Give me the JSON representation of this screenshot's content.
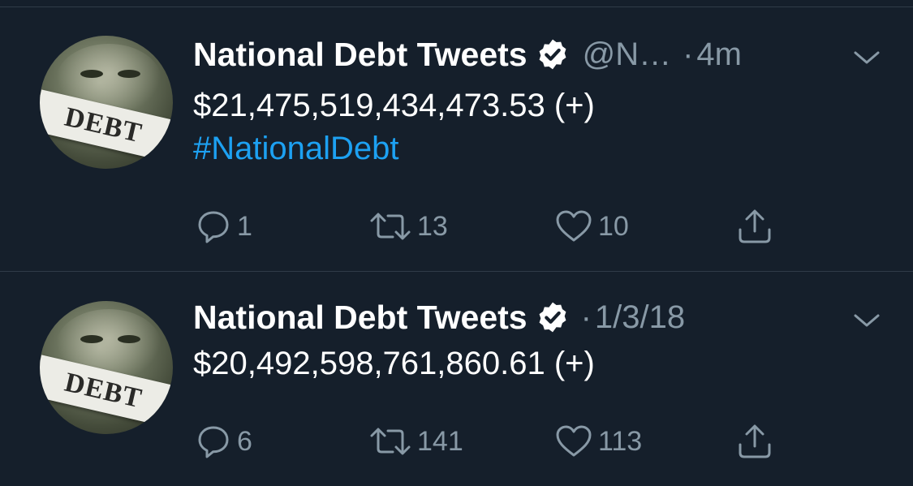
{
  "tweets": [
    {
      "name": "National Debt Tweets",
      "handle": "@N…",
      "separator": "·",
      "time": "4m",
      "text": "$21,475,519,434,473.53 (+)",
      "hashtag": "#NationalDebt",
      "replies": "1",
      "retweets": "13",
      "likes": "10",
      "avatar_text": "DEBT"
    },
    {
      "name": "National Debt Tweets",
      "handle": "",
      "separator": "·",
      "time": "1/3/18",
      "text": "$20,492,598,761,860.61 (+)",
      "hashtag": "",
      "replies": "6",
      "retweets": "141",
      "likes": "113",
      "avatar_text": "DEBT"
    }
  ],
  "colors": {
    "background": "#151f2b",
    "text": "#ffffff",
    "secondary": "#8899a6",
    "link": "#1da1f2",
    "divider": "#2f3b48"
  },
  "icons": [
    "verified-badge-icon",
    "chevron-down-icon",
    "reply-icon",
    "retweet-icon",
    "like-icon",
    "share-icon"
  ]
}
